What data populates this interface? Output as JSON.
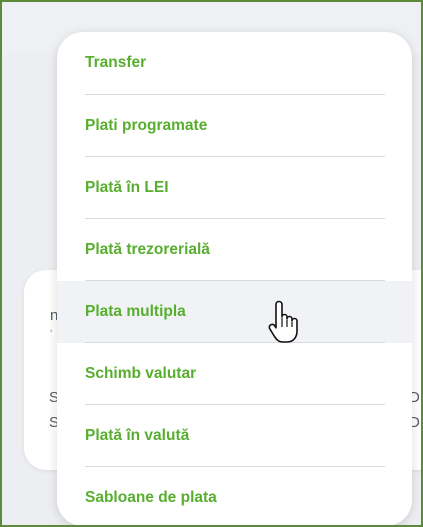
{
  "background": {
    "fragments": {
      "m1": "n",
      "m2": "'",
      "s1": "S",
      "s2": "S",
      "r1": "D",
      "r2": "D"
    }
  },
  "menu": {
    "items": [
      {
        "label": "Transfer"
      },
      {
        "label": "Plati programate"
      },
      {
        "label": "Plată în LEI"
      },
      {
        "label": "Plată trezorerială"
      },
      {
        "label": "Plata multipla",
        "hovered": true
      },
      {
        "label": "Schimb valutar"
      },
      {
        "label": "Plată în valută"
      },
      {
        "label": "Sabloane de plata"
      }
    ]
  },
  "cursor": {
    "icon": "hand-pointer-icon"
  },
  "colors": {
    "accent_text": "#58ae2f",
    "frame_border": "#5d8a3a",
    "hover_bg": "#f1f2f5",
    "separator": "#d7dade"
  }
}
